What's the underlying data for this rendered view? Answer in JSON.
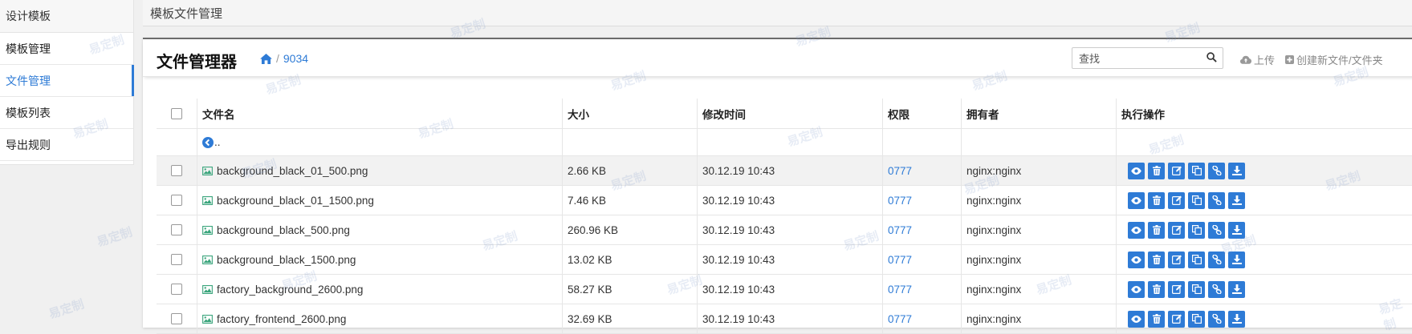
{
  "sidebar": {
    "title": "设计模板",
    "items": [
      {
        "label": "模板管理",
        "active": false
      },
      {
        "label": "文件管理",
        "active": true
      },
      {
        "label": "模板列表",
        "active": false
      },
      {
        "label": "导出规则",
        "active": false
      }
    ]
  },
  "topbar": {
    "title": "模板文件管理"
  },
  "panel": {
    "title": "文件管理器",
    "breadcrumb": {
      "home_icon": "home-icon",
      "separator": "/",
      "current": "9034"
    },
    "search": {
      "placeholder": "查找"
    },
    "upload_label": "上传",
    "create_label": "创建新文件/文件夹"
  },
  "table": {
    "headers": {
      "name": "文件名",
      "size": "大小",
      "mtime": "修改时间",
      "perm": "权限",
      "owner": "拥有者",
      "actions": "执行操作"
    },
    "parent_label": "..",
    "rows": [
      {
        "name": "background_black_01_500.png",
        "size": "2.66 KB",
        "mtime": "30.12.19 10:43",
        "perm": "0777",
        "owner": "nginx:nginx"
      },
      {
        "name": "background_black_01_1500.png",
        "size": "7.46 KB",
        "mtime": "30.12.19 10:43",
        "perm": "0777",
        "owner": "nginx:nginx"
      },
      {
        "name": "background_black_500.png",
        "size": "260.96 KB",
        "mtime": "30.12.19 10:43",
        "perm": "0777",
        "owner": "nginx:nginx"
      },
      {
        "name": "background_black_1500.png",
        "size": "13.02 KB",
        "mtime": "30.12.19 10:43",
        "perm": "0777",
        "owner": "nginx:nginx"
      },
      {
        "name": "factory_background_2600.png",
        "size": "58.27 KB",
        "mtime": "30.12.19 10:43",
        "perm": "0777",
        "owner": "nginx:nginx"
      },
      {
        "name": "factory_frontend_2600.png",
        "size": "32.69 KB",
        "mtime": "30.12.19 10:43",
        "perm": "0777",
        "owner": "nginx:nginx"
      }
    ],
    "action_icons": [
      "eye-icon",
      "trash-icon",
      "edit-icon",
      "copy-icon",
      "link-icon",
      "download-icon"
    ]
  },
  "watermark": {
    "label": "易定制"
  },
  "colors": {
    "accent": "#2e7bd6",
    "file_icon": "#3aa57c"
  }
}
